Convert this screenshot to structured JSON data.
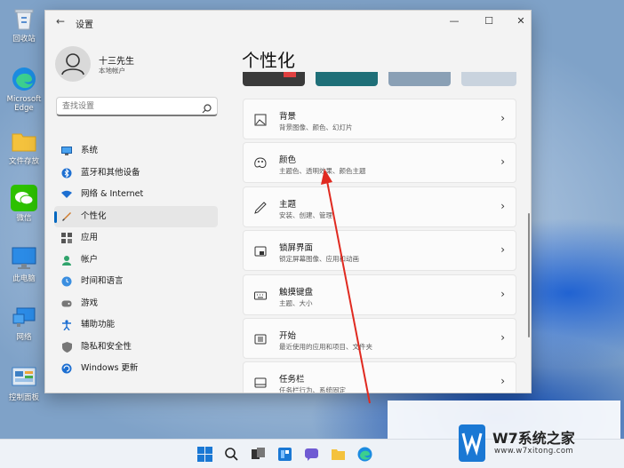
{
  "desktop": {
    "icons": [
      {
        "id": "recycle",
        "label": "回收站"
      },
      {
        "id": "edge",
        "label": "Microsoft Edge"
      },
      {
        "id": "folder",
        "label": "文件存放"
      },
      {
        "id": "wechat",
        "label": "微信"
      },
      {
        "id": "computer",
        "label": "此电脑"
      },
      {
        "id": "network",
        "label": "网络"
      },
      {
        "id": "control",
        "label": "控制面板"
      }
    ]
  },
  "window": {
    "title": "设置",
    "back_symbol": "←",
    "minimize_symbol": "—",
    "maximize_symbol": "☐",
    "close_symbol": "✕"
  },
  "user": {
    "name": "十三先生",
    "subtitle": "本地帐户"
  },
  "search": {
    "placeholder": "查找设置"
  },
  "nav": {
    "items": [
      {
        "label": "系统",
        "icon": "monitor-icon"
      },
      {
        "label": "蓝牙和其他设备",
        "icon": "bluetooth-icon"
      },
      {
        "label": "网络 & Internet",
        "icon": "wifi-icon"
      },
      {
        "label": "个性化",
        "icon": "brush-icon",
        "active": true
      },
      {
        "label": "应用",
        "icon": "apps-icon"
      },
      {
        "label": "帐户",
        "icon": "person-icon"
      },
      {
        "label": "时间和语言",
        "icon": "globe-clock-icon"
      },
      {
        "label": "游戏",
        "icon": "gamepad-icon"
      },
      {
        "label": "辅助功能",
        "icon": "accessibility-icon"
      },
      {
        "label": "隐私和安全性",
        "icon": "shield-icon"
      },
      {
        "label": "Windows 更新",
        "icon": "update-icon"
      }
    ]
  },
  "main": {
    "title": "个性化",
    "cards": [
      {
        "title": "背景",
        "subtitle": "背景图像、颜色、幻灯片",
        "icon": "image-icon"
      },
      {
        "title": "颜色",
        "subtitle": "主题色、透明效果、颜色主题",
        "icon": "palette-icon"
      },
      {
        "title": "主题",
        "subtitle": "安装、创建、管理",
        "icon": "pen-icon"
      },
      {
        "title": "锁屏界面",
        "subtitle": "锁定屏幕图像、应用和动画",
        "icon": "lockscreen-icon"
      },
      {
        "title": "触摸键盘",
        "subtitle": "主题、大小",
        "icon": "keyboard-icon"
      },
      {
        "title": "开始",
        "subtitle": "最近使用的应用和项目、文件夹",
        "icon": "start-icon"
      },
      {
        "title": "任务栏",
        "subtitle": "任务栏行为、系统固定",
        "icon": "taskbar-icon"
      }
    ],
    "chevron": "›"
  },
  "watermark": {
    "name": "W7系统之家",
    "url": "www.w7xitong.com"
  },
  "colors": {
    "accent": "#0067c0",
    "arrow": "#e02a20"
  }
}
